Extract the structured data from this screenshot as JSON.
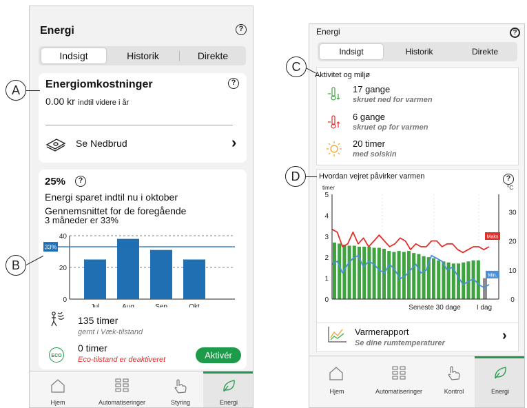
{
  "left": {
    "title": "Energi",
    "help_icon": "?",
    "segments": [
      "Indsigt",
      "Historik",
      "Direkte"
    ],
    "cost_card": {
      "title": "Energiomkostninger",
      "amount": "0.00 kr",
      "amount_suffix": "indtil videre i år",
      "link": "Se Nedbrud",
      "chevron": "›"
    },
    "savings_card": {
      "percent": "25%",
      "line1": "Energi sparet indtil nu i oktober",
      "line2": "Gennemsnittet for de foregående",
      "line3": "3 måneder er 33%",
      "avg_badge": "33%",
      "vacation_value": "135 timer",
      "vacation_sub": "gemt i Væk-tilstand",
      "eco_value": "0 timer",
      "eco_sub": "Eco-tilstand er deaktiveret",
      "eco_badge": "ECO",
      "activate_button": "Aktivér"
    },
    "tabs": [
      "Hjem",
      "Automatiseringer",
      "Styring",
      "Energi"
    ]
  },
  "right": {
    "title": "Energi",
    "help_icon": "?",
    "segments": [
      "Indsigt",
      "Historik",
      "Direkte"
    ],
    "activity": {
      "title": "Aktivitet og miljø",
      "items": [
        {
          "icon": "thermometer-down-icon",
          "value": "17 gange",
          "sub": "skruet ned for varmen"
        },
        {
          "icon": "thermometer-up-icon",
          "value": "6 gange",
          "sub": "skruet op for varmen"
        },
        {
          "icon": "sun-icon",
          "value": "20 timer",
          "sub": "med solskin"
        }
      ]
    },
    "weather": {
      "title": "Hvordan vejret påvirker varmen",
      "left_unit": "timer",
      "right_unit": "°C",
      "maks_label": "Maks",
      "min_label": "Min.",
      "x_label_recent": "Seneste 30 dage",
      "x_label_today": "I dag"
    },
    "report": {
      "title": "Varmerapport",
      "sub": "Se dine rumtemperaturer",
      "chevron": "›"
    },
    "tabs": [
      "Hjem",
      "Automatiseringer",
      "Kontrol",
      "Energi"
    ]
  },
  "callouts": [
    "A",
    "B",
    "C",
    "D"
  ],
  "chart_data": [
    {
      "type": "bar",
      "categories": [
        "Jul",
        "Aug",
        "Sep",
        "Okt"
      ],
      "values": [
        25,
        38,
        31,
        25
      ],
      "ylim": [
        0,
        40
      ],
      "yticks": [
        0,
        20,
        40
      ],
      "reference_line": 33,
      "colors": {
        "bar": "#1f6fb2",
        "reference": "#1f6fb2"
      }
    },
    {
      "type": "bar",
      "xlabel": "Seneste 30 dage",
      "left_axis": {
        "label": "timer",
        "range": [
          0,
          5
        ],
        "ticks": [
          0,
          1,
          2,
          3,
          4,
          5
        ]
      },
      "right_axis": {
        "label": "°C",
        "range": [
          0,
          36
        ],
        "ticks": [
          0,
          10,
          20,
          30
        ]
      },
      "bars_hours": [
        2.7,
        2.65,
        2.6,
        2.55,
        2.55,
        2.5,
        2.5,
        2.5,
        2.45,
        2.45,
        2.4,
        2.3,
        2.25,
        2.3,
        2.25,
        2.3,
        2.2,
        2.15,
        2.05,
        2.0,
        1.95,
        1.85,
        1.8,
        1.75,
        1.7,
        1.7,
        1.75,
        1.8,
        1.85,
        1.85
      ],
      "today_hours": 1.0,
      "series": [
        {
          "name": "Maks",
          "values": [
            24,
            23,
            18,
            19,
            23,
            19,
            21,
            18,
            20,
            22,
            20,
            18,
            19,
            21,
            20,
            17,
            19,
            18,
            18,
            20,
            20,
            18,
            19,
            19,
            17,
            16,
            17,
            18,
            18,
            17,
            18
          ]
        },
        {
          "name": "Min.",
          "values": [
            12,
            13,
            9,
            12,
            14,
            15,
            11,
            13,
            12,
            10,
            9,
            12,
            10,
            7,
            8,
            10,
            12,
            9,
            10,
            15,
            14,
            13,
            10,
            11,
            8,
            5,
            6,
            7,
            5,
            4,
            5
          ]
        }
      ],
      "colors": {
        "bars": "#3fa33f",
        "today": "#8c8c8c",
        "max": "#e0302c",
        "min": "#4a90d9"
      }
    }
  ]
}
